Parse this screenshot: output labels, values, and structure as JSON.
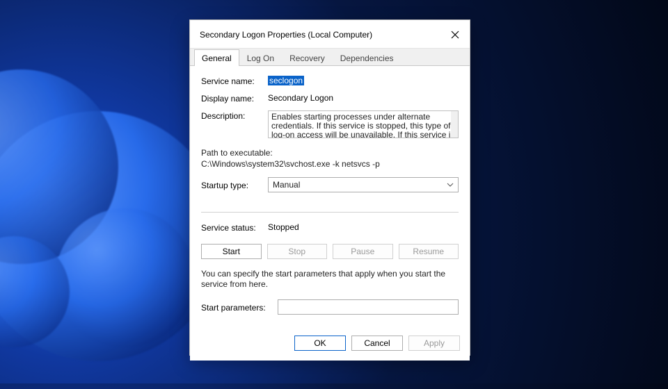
{
  "window": {
    "title": "Secondary Logon Properties (Local Computer)"
  },
  "tabs": {
    "general": "General",
    "logon": "Log On",
    "recovery": "Recovery",
    "dependencies": "Dependencies"
  },
  "labels": {
    "service_name": "Service name:",
    "display_name": "Display name:",
    "description": "Description:",
    "path": "Path to executable:",
    "startup_type": "Startup type:",
    "service_status": "Service status:",
    "start_parameters": "Start parameters:"
  },
  "values": {
    "service_name": "seclogon",
    "display_name": "Secondary Logon",
    "description": "Enables starting processes under alternate credentials. If this service is stopped, this type of log-on access will be unavailable. If this service is",
    "path": "C:\\Windows\\system32\\svchost.exe -k netsvcs -p",
    "startup_type": "Manual",
    "service_status": "Stopped",
    "start_parameters": ""
  },
  "buttons": {
    "start": "Start",
    "stop": "Stop",
    "pause": "Pause",
    "resume": "Resume",
    "ok": "OK",
    "cancel": "Cancel",
    "apply": "Apply"
  },
  "hint": "You can specify the start parameters that apply when you start the service from here."
}
